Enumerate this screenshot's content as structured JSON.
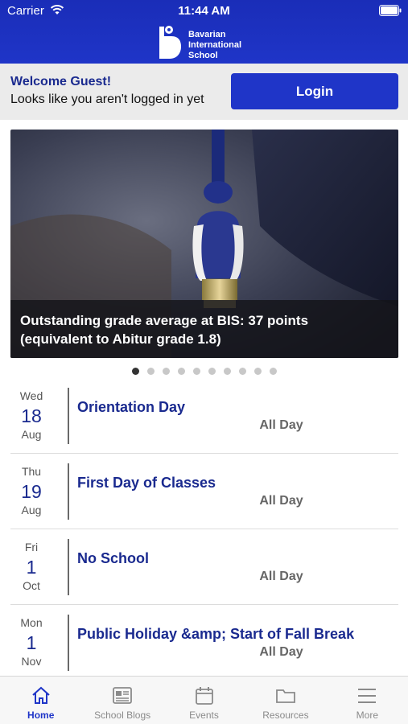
{
  "status": {
    "carrier": "Carrier",
    "time": "11:44 AM"
  },
  "brand": {
    "line1": "Bavarian",
    "line2": "International",
    "line3": "School"
  },
  "welcome": {
    "title": "Welcome Guest!",
    "subtitle": "Looks like you aren't logged in yet",
    "login_label": "Login"
  },
  "carousel": {
    "caption_line1": "Outstanding grade average at BIS: 37 points",
    "caption_line2": "(equivalent to Abitur grade 1.8)",
    "dot_count": 10,
    "active_index": 0
  },
  "events": [
    {
      "dow": "Wed",
      "day": "18",
      "mon": "Aug",
      "title": "Orientation Day",
      "time": "All Day"
    },
    {
      "dow": "Thu",
      "day": "19",
      "mon": "Aug",
      "title": "First Day of Classes",
      "time": "All Day"
    },
    {
      "dow": "Fri",
      "day": "1",
      "mon": "Oct",
      "title": "No School",
      "time": "All Day"
    },
    {
      "dow": "Mon",
      "day": "1",
      "mon": "Nov",
      "title": "Public Holiday &amp; Start of Fall Break",
      "time": "All Day"
    }
  ],
  "tabs": [
    {
      "label": "Home",
      "icon": "home-icon",
      "active": true
    },
    {
      "label": "School Blogs",
      "icon": "newspaper-icon",
      "active": false
    },
    {
      "label": "Events",
      "icon": "calendar-icon",
      "active": false
    },
    {
      "label": "Resources",
      "icon": "folder-icon",
      "active": false
    },
    {
      "label": "More",
      "icon": "menu-icon",
      "active": false
    }
  ],
  "colors": {
    "brand_blue": "#1f35c8",
    "title_blue": "#1a2a8f",
    "welcome_bg": "#ebebeb"
  }
}
